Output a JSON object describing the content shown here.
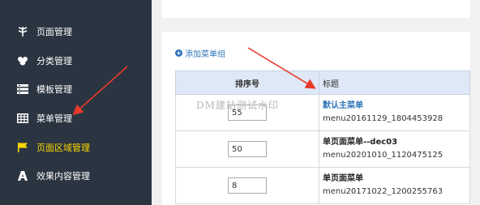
{
  "sidebar": {
    "items": [
      {
        "label": "页面管理",
        "icon": "leaf-icon",
        "active": false
      },
      {
        "label": "分类管理",
        "icon": "people-icon",
        "active": false
      },
      {
        "label": "模板管理",
        "icon": "template-icon",
        "active": false
      },
      {
        "label": "菜单管理",
        "icon": "table-icon",
        "active": false
      },
      {
        "label": "页面区域管理",
        "icon": "flag-icon",
        "active": true
      },
      {
        "label": "效果内容管理",
        "icon": "effect-icon",
        "active": false
      }
    ]
  },
  "main": {
    "add_group_label": "添加菜单组",
    "table": {
      "headers": {
        "order": "排序号",
        "title": "标题"
      },
      "rows": [
        {
          "order": "55",
          "title": "默认主菜单",
          "code": "menu20161129_1804453928",
          "title_is_link": true
        },
        {
          "order": "50",
          "title": "单页面菜单--dec03",
          "code": "menu20201010_1120475125",
          "title_is_link": false
        },
        {
          "order": "8",
          "title": "单页面菜单",
          "code": "menu20171022_1200255763",
          "title_is_link": false
        }
      ]
    },
    "watermark": "DM建站测试水印"
  },
  "colors": {
    "sidebar_bg": "#2b3541",
    "active_text": "#ffd800",
    "link": "#2e72b8",
    "header_bg": "#dfe8f6",
    "arrow": "#e8392b"
  }
}
